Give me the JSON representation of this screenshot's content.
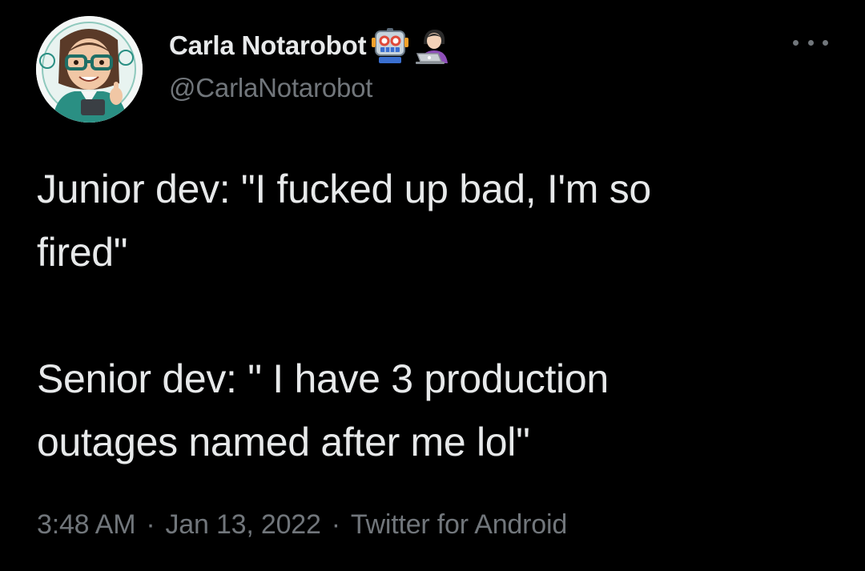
{
  "author": {
    "display_name": "Carla Notarobot",
    "handle": "@CarlaNotarobot",
    "name_emojis": [
      "robot-face-emoji",
      "woman-technologist-emoji"
    ]
  },
  "tweet": {
    "lines": [
      "Junior dev: \"I fucked up bad, I'm so",
      "fired\"",
      "Senior dev: \" I have 3 production",
      "outages named after me lol\""
    ]
  },
  "meta": {
    "time": "3:48 AM",
    "separator": "·",
    "date": "Jan 13, 2022",
    "source": "Twitter for Android"
  },
  "colors": {
    "background": "#000000",
    "primary_text": "#e7e9ea",
    "secondary_text": "#71767b"
  },
  "icons": {
    "more": "more-options-icon",
    "avatar": "avatar"
  }
}
